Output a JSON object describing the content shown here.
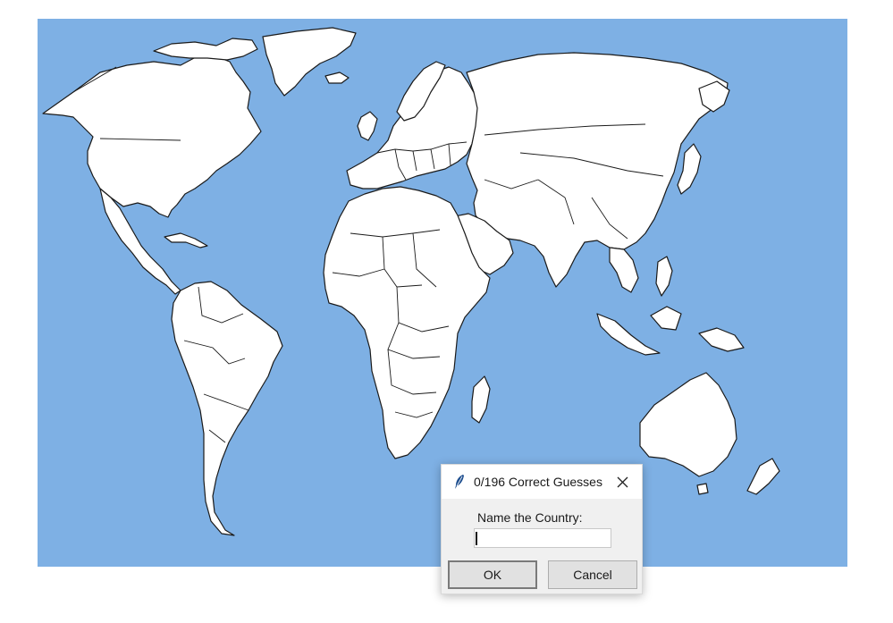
{
  "map": {
    "ocean_color": "#7eb0e4",
    "land_color": "#ffffff",
    "border_color": "#1a1a1a"
  },
  "dialog": {
    "icon": "feather-icon",
    "title": "0/196 Correct Guesses",
    "close_icon": "close-icon",
    "prompt": "Name the Country:",
    "input_value": "",
    "ok_label": "OK",
    "cancel_label": "Cancel"
  }
}
